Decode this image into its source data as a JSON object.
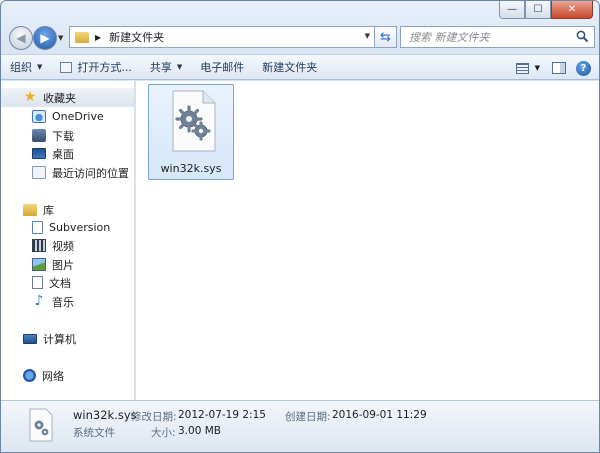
{
  "window": {
    "minimize_glyph": "—",
    "maximize_glyph": "☐",
    "close_glyph": "✕"
  },
  "address": {
    "path_folder": "新建文件夹"
  },
  "search": {
    "placeholder": "搜索 新建文件夹"
  },
  "toolbar": {
    "organize": "组织",
    "open_with": "打开方式...",
    "share": "共享",
    "email": "电子邮件",
    "new_folder": "新建文件夹"
  },
  "sidebar": {
    "favorites": {
      "label": "收藏夹",
      "items": [
        {
          "label": "OneDrive",
          "icon": "onedrive-icon"
        },
        {
          "label": "下载",
          "icon": "downloads-icon"
        },
        {
          "label": "桌面",
          "icon": "desktop-icon"
        },
        {
          "label": "最近访问的位置",
          "icon": "recent-places-icon"
        }
      ]
    },
    "libraries": {
      "label": "库",
      "items": [
        {
          "label": "Subversion",
          "icon": "subversion-icon"
        },
        {
          "label": "视频",
          "icon": "videos-icon"
        },
        {
          "label": "图片",
          "icon": "pictures-icon"
        },
        {
          "label": "文档",
          "icon": "documents-icon"
        },
        {
          "label": "音乐",
          "icon": "music-icon"
        }
      ]
    },
    "computer": {
      "label": "计算机"
    },
    "network": {
      "label": "网络"
    }
  },
  "files": [
    {
      "name": "win32k.sys",
      "icon": "system-file-gear-icon",
      "selected": true
    }
  ],
  "details": {
    "name": "win32k.sys",
    "type": "系统文件",
    "modified_label": "修改日期:",
    "modified_value": "2012-07-19 2:15",
    "size_label": "大小:",
    "size_value": "3.00 MB",
    "created_label": "创建日期:",
    "created_value": "2016-09-01 11:29"
  },
  "colors": {
    "accent": "#1e395b",
    "selection": "#d5e7fa",
    "chrome": "#d6e3f2"
  }
}
